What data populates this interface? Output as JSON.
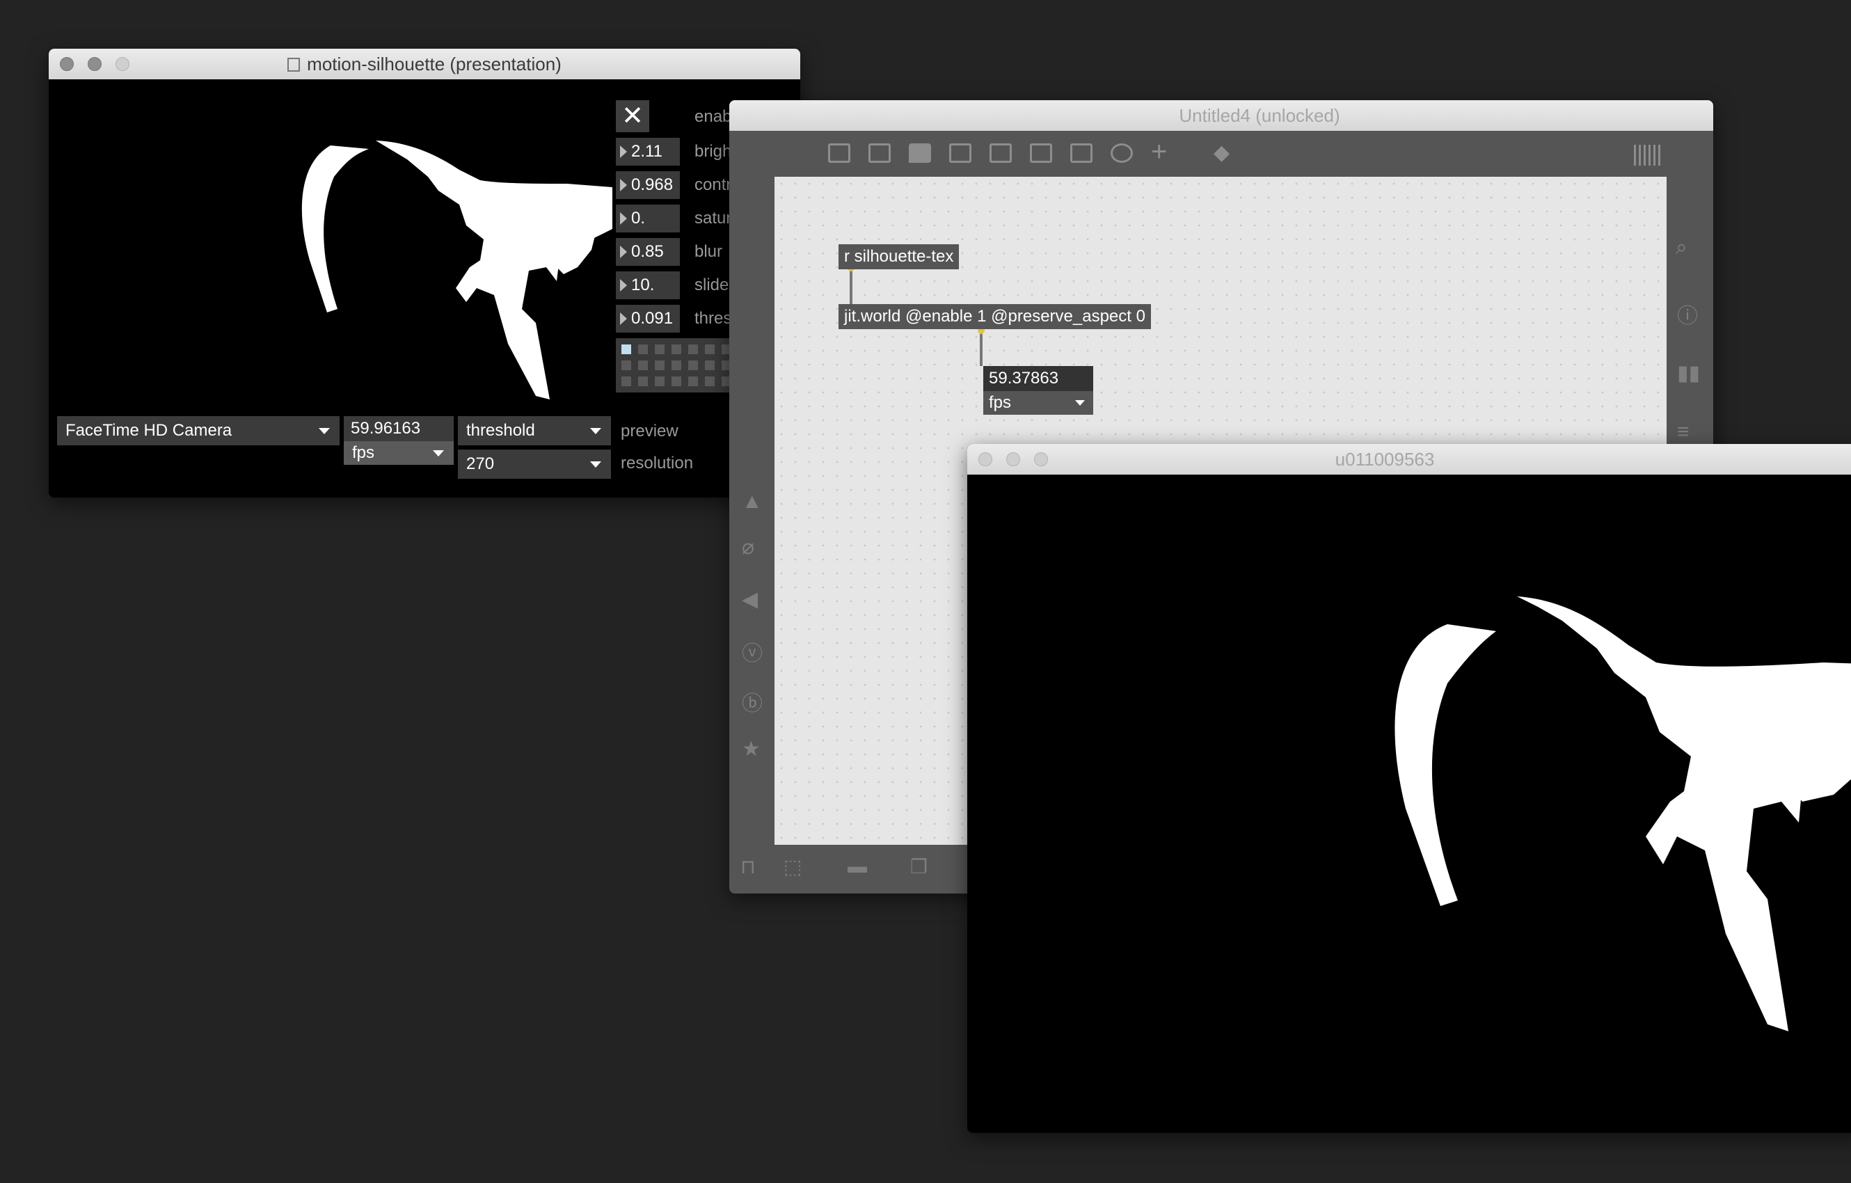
{
  "presentation": {
    "title": "motion-silhouette (presentation)",
    "enable_label": "enable",
    "params": [
      {
        "value": "2.11",
        "label": "brightness"
      },
      {
        "value": "0.968",
        "label": "contrast"
      },
      {
        "value": "0.",
        "label": "saturation"
      },
      {
        "value": "0.85",
        "label": "blur"
      },
      {
        "value": "10.",
        "label": "slide"
      },
      {
        "value": "0.091",
        "label": "threshold"
      }
    ],
    "camera_select": "FaceTime HD Camera",
    "fps_value": "59.96163",
    "fps_unit": "fps",
    "preview_select": "threshold",
    "preview_label": "preview",
    "resolution_select": "270",
    "resolution_label": "resolution"
  },
  "patcher": {
    "title": "Untitled4 (unlocked)",
    "objects": {
      "receive": "r silhouette-tex",
      "world": "jit.world @enable 1 @preserve_aspect 0",
      "fps_value": "59.37863",
      "fps_unit": "fps"
    }
  },
  "output": {
    "title": "u011009563"
  },
  "colors": {
    "desktop": "#232323",
    "object_box": "#555555",
    "canvas": "#e6e6e6"
  }
}
